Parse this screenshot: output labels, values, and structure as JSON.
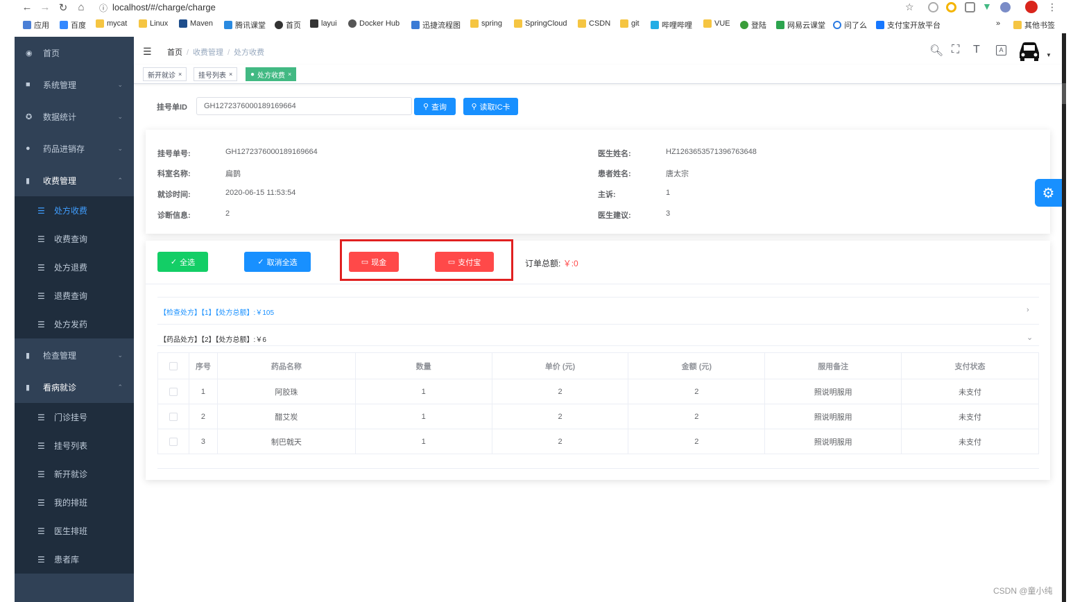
{
  "browser": {
    "url": "localhost/#/charge/charge",
    "bookmarks": [
      "应用",
      "百度",
      "mycat",
      "Linux",
      "Maven",
      "腾讯课堂",
      "首页",
      "layui",
      "Docker Hub",
      "迅捷流程图",
      "spring",
      "SpringCloud",
      "CSDN",
      "git",
      "哔哩哔哩",
      "VUE",
      "登陆",
      "网易云课堂",
      "问了么",
      "支付宝开放平台",
      "»",
      "其他书签"
    ]
  },
  "sidebar": {
    "menus": [
      {
        "label": "首页",
        "icon": "dashboard-icon",
        "arrow": ""
      },
      {
        "label": "系统管理",
        "icon": "lock-icon",
        "arrow": "⌄"
      },
      {
        "label": "数据统计",
        "icon": "chart-icon",
        "arrow": "⌄"
      },
      {
        "label": "药品进销存",
        "icon": "drug-icon",
        "arrow": "⌄"
      },
      {
        "label": "收费管理",
        "icon": "book-icon",
        "arrow": "⌃"
      }
    ],
    "charge_items": [
      "处方收费",
      "收费查询",
      "处方退费",
      "退费查询",
      "处方发药"
    ],
    "menus2": [
      {
        "label": "检查管理",
        "icon": "book-icon",
        "arrow": "⌄"
      },
      {
        "label": "看病就诊",
        "icon": "book-icon",
        "arrow": "⌃"
      }
    ],
    "visit_items": [
      "门诊挂号",
      "挂号列表",
      "新开就诊",
      "我的排班",
      "医生排班",
      "患者库"
    ]
  },
  "header": {
    "breadcrumb": [
      "首页",
      "收费管理",
      "处方收费"
    ]
  },
  "tags": [
    {
      "label": "新开就诊",
      "active": false
    },
    {
      "label": "挂号列表",
      "active": false
    },
    {
      "label": "处方收费",
      "active": true
    }
  ],
  "search": {
    "label": "挂号单ID",
    "value": "GH1272376000189169664",
    "query_btn": "查询",
    "ic_btn": "读取IC卡"
  },
  "info": {
    "reg_no_label": "挂号单号:",
    "reg_no": "GH1272376000189169664",
    "dept_label": "科室名称:",
    "dept": "扁鹊",
    "time_label": "就诊时间:",
    "time": "2020-06-15 11:53:54",
    "diag_label": "诊断信息:",
    "diag": "2",
    "doctor_label": "医生姓名:",
    "doctor": "HZ1263653571396763648",
    "patient_label": "患者姓名:",
    "patient": "唐太宗",
    "complaint_label": "主诉:",
    "complaint": "1",
    "advice_label": "医生建议:",
    "advice": "3"
  },
  "actions": {
    "select_all": "全选",
    "cancel_all": "取消全选",
    "cash": "现金",
    "alipay": "支付宝",
    "total_label": "订单总额:",
    "total_value": "￥:0"
  },
  "prescriptions": {
    "check_head": "【检查处方】【1】【处方总额】:￥105",
    "drug_head": "【药品处方】【2】【处方总额】:￥6"
  },
  "table": {
    "headers": [
      "序号",
      "药品名称",
      "数量",
      "单价 (元)",
      "金额 (元)",
      "服用备注",
      "支付状态"
    ],
    "rows": [
      [
        "1",
        "阿胶珠",
        "1",
        "2",
        "2",
        "照说明服用",
        "未支付"
      ],
      [
        "2",
        "醋艾炭",
        "1",
        "2",
        "2",
        "照说明服用",
        "未支付"
      ],
      [
        "3",
        "制巴戟天",
        "1",
        "2",
        "2",
        "照说明服用",
        "未支付"
      ]
    ]
  },
  "watermark": "CSDN @童小纯",
  "colors": {
    "sidebar_bg": "#304156",
    "primary": "#1890ff",
    "success": "#13ce66",
    "danger": "#ff4949",
    "tag_active": "#42b983"
  }
}
